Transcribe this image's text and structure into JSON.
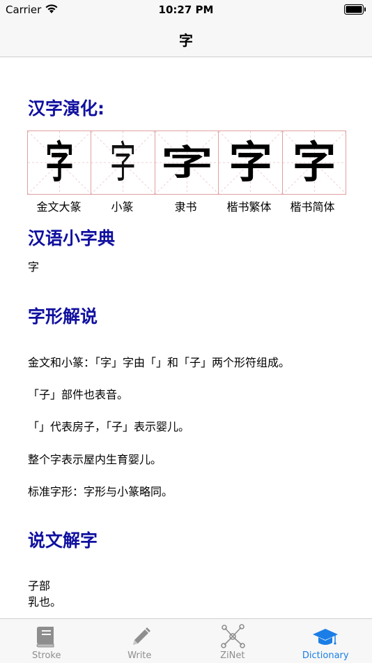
{
  "status_bar": {
    "carrier": "Carrier",
    "time": "10:27 PM"
  },
  "nav": {
    "title": "字"
  },
  "evolution": {
    "heading": "汉字演化:",
    "items": [
      {
        "glyph": "字",
        "label": "金文大篆"
      },
      {
        "glyph": "字",
        "label": "小篆"
      },
      {
        "glyph": "字",
        "label": "隶书"
      },
      {
        "glyph": "字",
        "label": "楷书繁体"
      },
      {
        "glyph": "字",
        "label": "楷书简体"
      }
    ]
  },
  "dictionary": {
    "heading": "汉语小字典",
    "text": "字"
  },
  "glyph_explanation": {
    "heading": "字形解说",
    "lines": [
      "金文和小篆：「字」字由「」和「子」两个形符组成。",
      "「子」部件也表音。",
      "「」代表房子，「子」表示婴儿。",
      "整个字表示屋内生育婴儿。",
      "标准字形：字形与小篆略同。"
    ]
  },
  "shuowen": {
    "heading": "说文解字",
    "lines": [
      "子部",
      "乳也。"
    ]
  },
  "tabs": [
    {
      "label": "Stroke",
      "icon": "book-icon"
    },
    {
      "label": "Write",
      "icon": "pencil-icon"
    },
    {
      "label": "ZiNet",
      "icon": "network-icon"
    },
    {
      "label": "Dictionary",
      "icon": "graduation-cap-icon",
      "active": true
    }
  ],
  "colors": {
    "heading": "#1010a0",
    "tab_active": "#1a7ee6",
    "tab_inactive": "#8e8e8e",
    "grid": "#e0a0a0"
  }
}
